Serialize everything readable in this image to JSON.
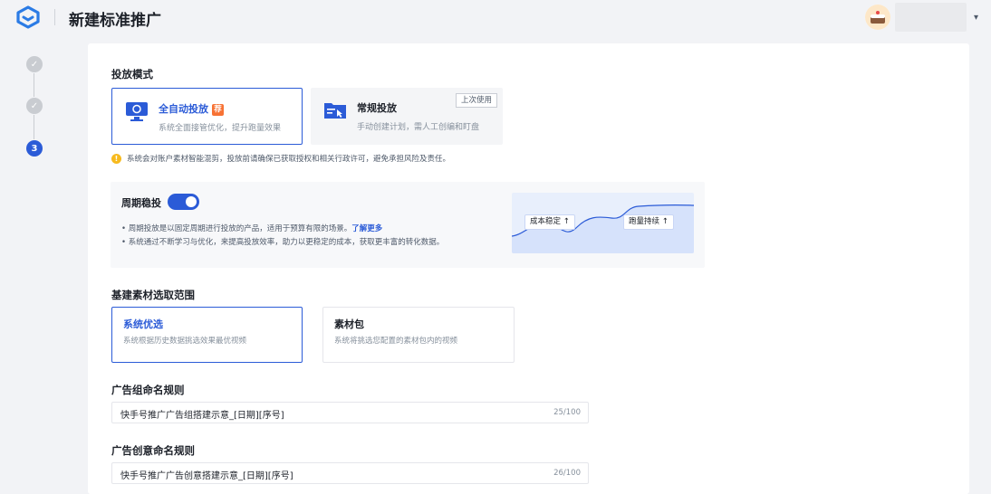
{
  "header": {
    "title": "新建标准推广",
    "logo_icon": "app-logo-icon",
    "avatar_icon": "user-avatar",
    "menu_caret": "▾"
  },
  "steps": [
    {
      "label": "✓",
      "state": "done"
    },
    {
      "label": "✓",
      "state": "done"
    },
    {
      "label": "3",
      "state": "active"
    }
  ],
  "delivery_mode": {
    "section_label": "投放模式",
    "options": [
      {
        "title": "全自动投放",
        "badge": "荐",
        "desc": "系统全面接管优化，提升跑量效果",
        "selected": true,
        "icon": "monitor-auto-icon"
      },
      {
        "title": "常规投放",
        "desc": "手动创建计划，需人工创编和盯盘",
        "tag": "上次使用",
        "selected": false,
        "icon": "folder-manual-icon"
      }
    ],
    "warning": "系统会对账户素材智能混剪，投放前请确保已获取授权和相关行政许可，避免承担风险及责任。"
  },
  "cycle": {
    "title": "周期稳投",
    "enabled": true,
    "bullets": [
      {
        "text": "周期投放是以固定周期进行投放的产品，适用于预算有限的场景。",
        "link": "了解更多"
      },
      {
        "text": "系统通过不断学习与优化，来提高投放效率，助力以更稳定的成本，获取更丰富的转化数据。"
      }
    ],
    "chart_tags": [
      "成本稳定 ↑",
      "跑量持续 ↑"
    ]
  },
  "material": {
    "section_label": "基建素材选取范围",
    "options": [
      {
        "title": "系统优选",
        "desc": "系统根据历史数据挑选效果最优视频",
        "selected": true
      },
      {
        "title": "素材包",
        "desc": "系统将挑选您配置的素材包内的视频",
        "selected": false
      }
    ]
  },
  "ad_group_name": {
    "label": "广告组命名规则",
    "value": "快手号推广广告组搭建示意_[日期][序号]",
    "count": "25/100"
  },
  "creative_name": {
    "label": "广告创意命名规则",
    "value": "快手号推广广告创意搭建示意_[日期][序号]",
    "count": "26/100"
  },
  "colors": {
    "primary": "#2b5bd7",
    "badge": "#f77234",
    "warning": "#f7ba1e"
  }
}
